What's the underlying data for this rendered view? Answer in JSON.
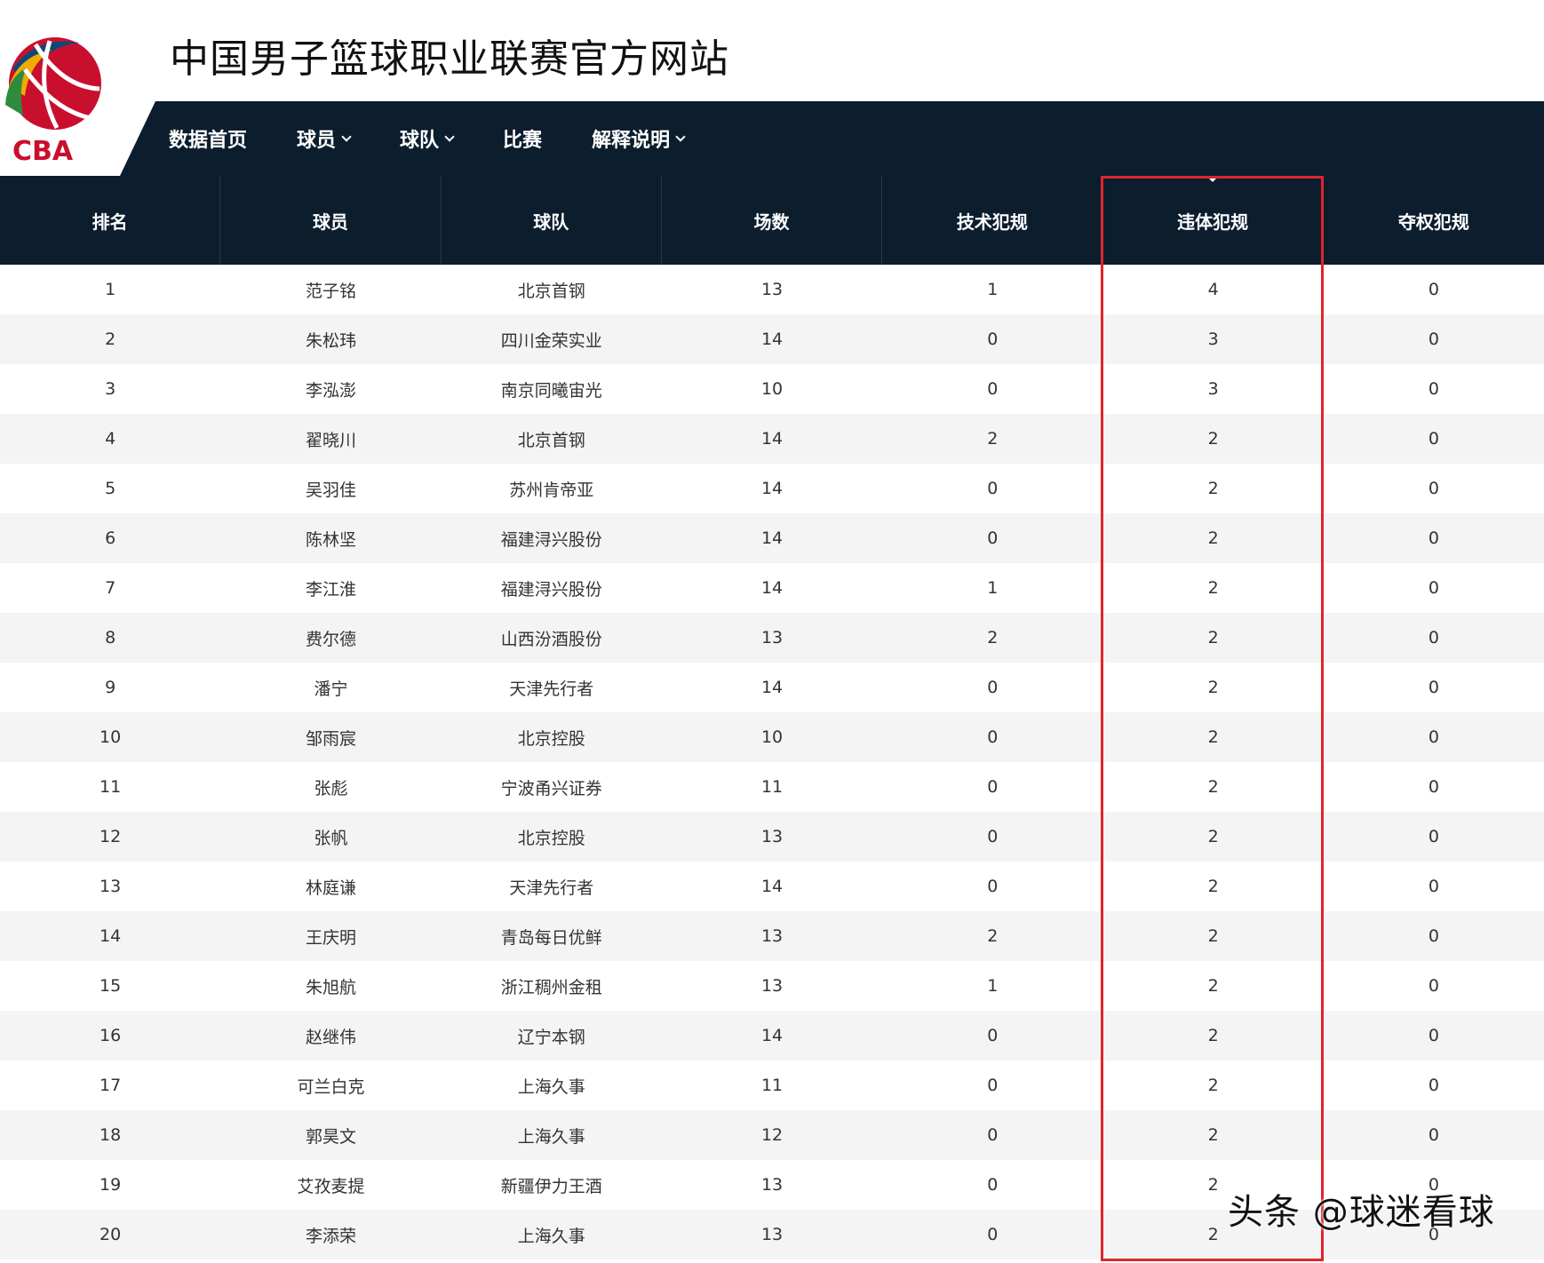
{
  "site": {
    "title": "中国男子篮球职业联赛官方网站",
    "logo_text": "CBA"
  },
  "nav": {
    "items": [
      {
        "label": "数据首页",
        "dropdown": false
      },
      {
        "label": "球员",
        "dropdown": true
      },
      {
        "label": "球队",
        "dropdown": true
      },
      {
        "label": "比赛",
        "dropdown": false
      },
      {
        "label": "解释说明",
        "dropdown": true
      }
    ]
  },
  "table": {
    "columns": [
      "排名",
      "球员",
      "球队",
      "场数",
      "技术犯规",
      "违体犯规",
      "夺权犯规"
    ],
    "sorted_column": "违体犯规",
    "rows": [
      [
        "1",
        "范子铭",
        "北京首钢",
        "13",
        "1",
        "4",
        "0"
      ],
      [
        "2",
        "朱松玮",
        "四川金荣实业",
        "14",
        "0",
        "3",
        "0"
      ],
      [
        "3",
        "李泓澎",
        "南京同曦宙光",
        "10",
        "0",
        "3",
        "0"
      ],
      [
        "4",
        "翟晓川",
        "北京首钢",
        "14",
        "2",
        "2",
        "0"
      ],
      [
        "5",
        "吴羽佳",
        "苏州肯帝亚",
        "14",
        "0",
        "2",
        "0"
      ],
      [
        "6",
        "陈林坚",
        "福建浔兴股份",
        "14",
        "0",
        "2",
        "0"
      ],
      [
        "7",
        "李江淮",
        "福建浔兴股份",
        "14",
        "1",
        "2",
        "0"
      ],
      [
        "8",
        "费尔德",
        "山西汾酒股份",
        "13",
        "2",
        "2",
        "0"
      ],
      [
        "9",
        "潘宁",
        "天津先行者",
        "14",
        "0",
        "2",
        "0"
      ],
      [
        "10",
        "邹雨宸",
        "北京控股",
        "10",
        "0",
        "2",
        "0"
      ],
      [
        "11",
        "张彪",
        "宁波甬兴证券",
        "11",
        "0",
        "2",
        "0"
      ],
      [
        "12",
        "张帆",
        "北京控股",
        "13",
        "0",
        "2",
        "0"
      ],
      [
        "13",
        "林庭谦",
        "天津先行者",
        "14",
        "0",
        "2",
        "0"
      ],
      [
        "14",
        "王庆明",
        "青岛每日优鲜",
        "13",
        "2",
        "2",
        "0"
      ],
      [
        "15",
        "朱旭航",
        "浙江稠州金租",
        "13",
        "1",
        "2",
        "0"
      ],
      [
        "16",
        "赵继伟",
        "辽宁本钢",
        "14",
        "0",
        "2",
        "0"
      ],
      [
        "17",
        "可兰白克",
        "上海久事",
        "11",
        "0",
        "2",
        "0"
      ],
      [
        "18",
        "郭昊文",
        "上海久事",
        "12",
        "0",
        "2",
        "0"
      ],
      [
        "19",
        "艾孜麦提",
        "新疆伊力王酒",
        "13",
        "0",
        "2",
        "0"
      ],
      [
        "20",
        "李添荣",
        "上海久事",
        "13",
        "0",
        "2",
        "0"
      ]
    ]
  },
  "colors": {
    "nav_bg": "#0c1d2e",
    "highlight": "#e0242c",
    "row_alt": "#f4f4f4"
  },
  "watermark": "头条 @球迷看球"
}
